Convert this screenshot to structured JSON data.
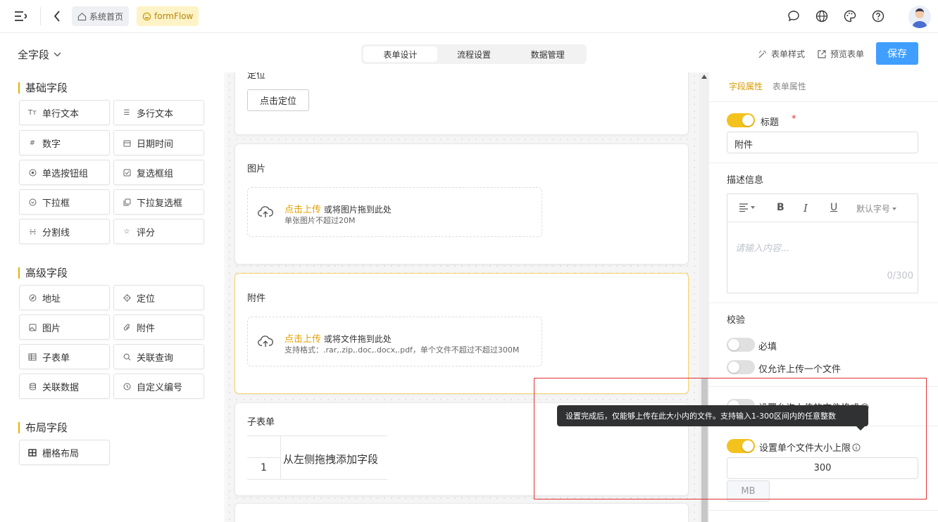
{
  "header": {
    "home_tag": "系统首页",
    "app_tag": "formFlow"
  },
  "toolbar": {
    "scope_label": "全字段",
    "tabs": [
      "表单设计",
      "流程设置",
      "数据管理"
    ],
    "style_label": "表单样式",
    "preview_label": "预览表单",
    "save_label": "保存"
  },
  "palette": {
    "groups": [
      {
        "title": "基础字段",
        "items": [
          "单行文本",
          "多行文本",
          "数字",
          "日期时间",
          "单选按钮组",
          "复选框组",
          "下拉框",
          "下拉复选框",
          "分割线",
          "评分"
        ]
      },
      {
        "title": "高级字段",
        "items": [
          "地址",
          "定位",
          "图片",
          "附件",
          "子表单",
          "关联查询",
          "关联数据",
          "自定义编号"
        ]
      },
      {
        "title": "布局字段",
        "items": [
          "栅格布局"
        ]
      }
    ]
  },
  "canvas": {
    "location_title": "定位",
    "location_button": "点击定位",
    "image_title": "图片",
    "image_upload_link": "点击上传",
    "image_upload_text": "或将图片拖到此处",
    "image_upload_hint": "单张图片不超过20M",
    "attach_title": "附件",
    "attach_upload_link": "点击上传",
    "attach_upload_text": "或将文件拖到此处",
    "attach_upload_hint": "支持格式：.rar,.zip,.doc,.docx,.pdf，单个文件不超过不超过300M",
    "subform_title": "子表单",
    "subform_row_num": "1",
    "subform_placeholder": "从左侧拖拽添加字段"
  },
  "props": {
    "tabs": [
      "字段属性",
      "表单属性"
    ],
    "title_label": "标题",
    "title_required_mark": "*",
    "title_value": "附件",
    "desc_label": "描述信息",
    "editor_font_size": "默认字号",
    "editor_placeholder": "请输入内容...",
    "editor_count": "0/300",
    "validate_label": "校验",
    "required_label": "必填",
    "single_upload_label": "仅允许上传一个文件",
    "file_type_label": "设置允许上传的文件格式",
    "file_size_label": "设置单个文件大小上限",
    "file_size_value": "300",
    "file_size_unit": "MB",
    "tooltip": "设置完成后，仅能够上传在此大小内的文件。支持输入1-300区间内的任意整数"
  },
  "colors": {
    "accent": "#f4c21c",
    "save_button": "#409eff",
    "tag_bg": "#fdf3c6",
    "annotation_red": "#e03131"
  }
}
